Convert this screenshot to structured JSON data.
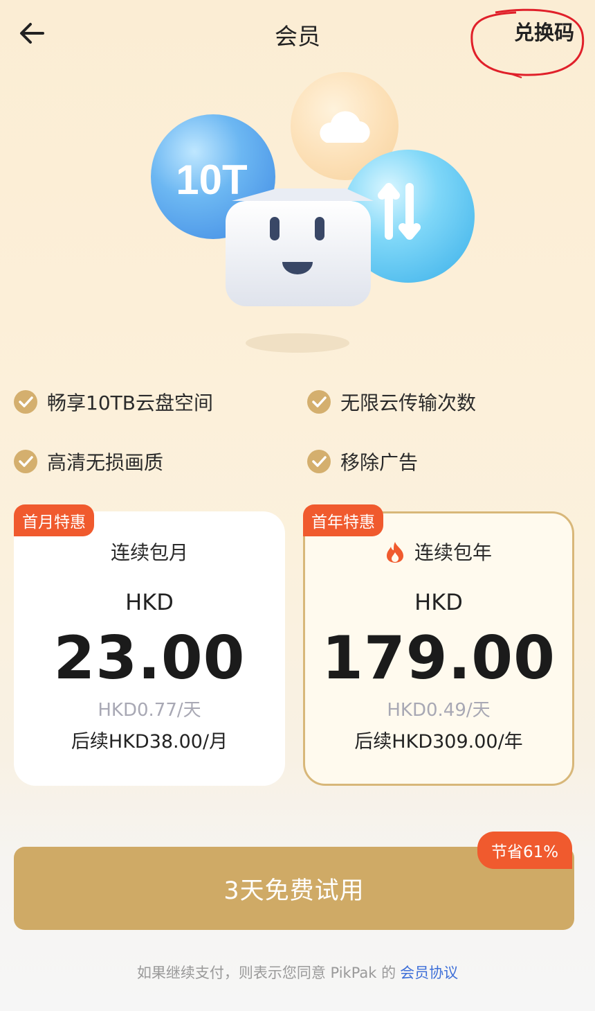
{
  "header": {
    "title": "会员",
    "redeem_label": "兑换码"
  },
  "hero": {
    "bubble_storage_label": "10T"
  },
  "features": [
    {
      "label": "畅享10TB云盘空间"
    },
    {
      "label": "无限云传输次数"
    },
    {
      "label": "高清无损画质"
    },
    {
      "label": "移除广告"
    }
  ],
  "plans": [
    {
      "badge": "首月特惠",
      "name": "连续包月",
      "currency": "HKD",
      "price": "23.00",
      "per_day": "HKD0.77/天",
      "renewal": "后续HKD38.00/月",
      "selected": false
    },
    {
      "badge": "首年特惠",
      "name": "连续包年",
      "currency": "HKD",
      "price": "179.00",
      "per_day": "HKD0.49/天",
      "renewal": "后续HKD309.00/年",
      "selected": true
    }
  ],
  "cta": {
    "label": "3天免费试用",
    "save_badge": "节省61%"
  },
  "footer": {
    "agreement_text": "如果继续支付，则表示您同意 PikPak 的",
    "agreement_link": "会员协议"
  },
  "colors": {
    "accent_gold": "#cfaa66",
    "badge_orange": "#f05a2e",
    "link_blue": "#3d6fd8",
    "annotation_red": "#e0202a"
  }
}
